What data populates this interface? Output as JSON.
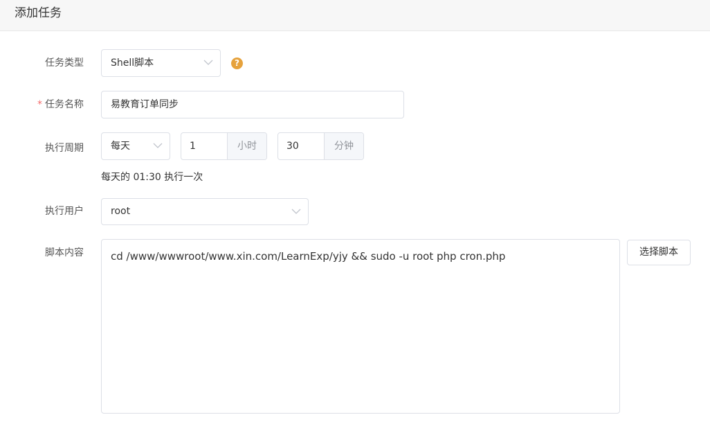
{
  "header": {
    "title": "添加任务"
  },
  "form": {
    "task_type": {
      "label": "任务类型",
      "value": "Shell脚本",
      "help_icon": "question-circle-icon",
      "help_symbol": "?"
    },
    "task_name": {
      "required_mark": "*",
      "label": "任务名称",
      "value": "易教育订单同步"
    },
    "period": {
      "label": "执行周期",
      "cycle_value": "每天",
      "hour_value": "1",
      "hour_suffix": "小时",
      "minute_value": "30",
      "minute_suffix": "分钟",
      "hint": "每天的 01:30 执行一次"
    },
    "user": {
      "label": "执行用户",
      "value": "root"
    },
    "script": {
      "label": "脚本内容",
      "content": "cd /www/wwwroot/www.xin.com/LearnExp/yjy && sudo -u root php cron.php",
      "select_button": "选择脚本"
    }
  },
  "colors": {
    "required": "#f56c6c",
    "help_icon": "#e6a23c",
    "border": "#dcdfe6",
    "suffix_bg": "#f5f7fa",
    "header_bg": "#f7f7f7"
  }
}
